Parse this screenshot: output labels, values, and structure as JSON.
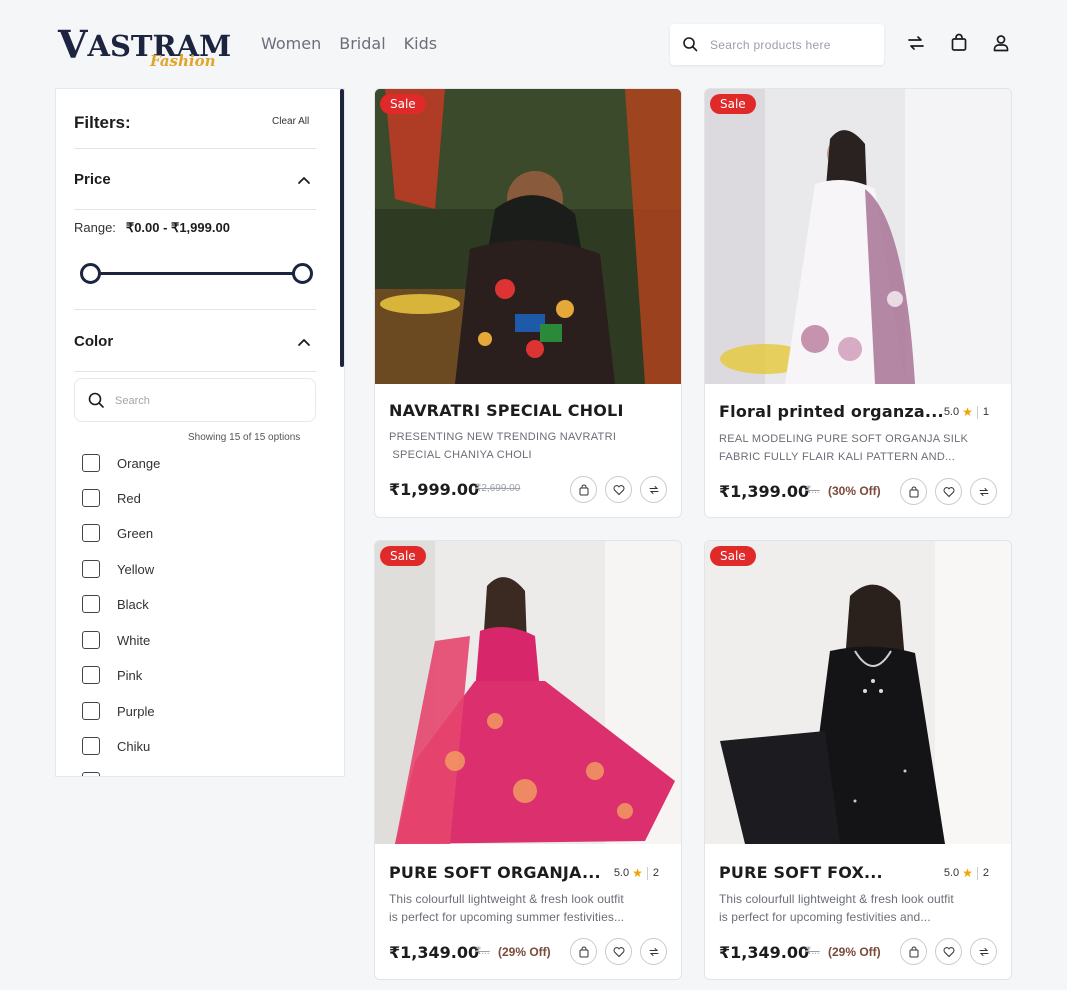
{
  "header": {
    "logo_main": "ASTRAM",
    "logo_v": "V",
    "logo_sub": "Fashion",
    "nav": [
      "Women",
      "Bridal",
      "Kids"
    ],
    "search_placeholder": "Search products here",
    "icons": [
      "search-icon",
      "compare-icon",
      "bag-icon",
      "user-icon"
    ]
  },
  "filters": {
    "title": "Filters:",
    "clear_all": "Clear All",
    "price": {
      "title": "Price",
      "range_label": "Range:",
      "range_value": "₹0.00 - ₹1,999.00",
      "min_fraction": 0,
      "max_fraction": 1
    },
    "color": {
      "title": "Color",
      "search_placeholder": "Search",
      "showing": "Showing 15 of 15 options",
      "options": [
        "Orange",
        "Red",
        "Green",
        "Yellow",
        "Black",
        "White",
        "Pink",
        "Purple",
        "Chiku"
      ]
    }
  },
  "products": [
    {
      "badge": "Sale",
      "name": "NAVRATRI SPECIAL CHOLI",
      "rating": "",
      "rating_count": "",
      "desc_line1": "PRESENTING NEW  TRENDING NAVRATRI",
      "desc_line2": " SPECIAL CHANIYA CHOLI",
      "price": "₹1,999.00",
      "mrp": "₹2,699.00",
      "off": ""
    },
    {
      "badge": "Sale",
      "name": "Floral printed organza...",
      "rating": "5.0",
      "rating_count": "1",
      "desc_line1": "REAL MODELING PURE SOFT ORGANJA SILK",
      "desc_line2": "FABRIC FULLY FLAIR KALI PATTERN AND...",
      "price": "₹1,399.00",
      "mrp": "₹...",
      "off": "(30% Off)"
    },
    {
      "badge": "Sale",
      "name": "PURE SOFT ORGANJA...",
      "rating": "5.0",
      "rating_count": "2",
      "desc_line1": "This colourfull lightweight & fresh look outfit",
      "desc_line2": "is perfect for upcoming summer festivities...",
      "price": "₹1,349.00",
      "mrp": "₹...",
      "off": "(29% Off)"
    },
    {
      "badge": "Sale",
      "name": "PURE SOFT FOX...",
      "rating": "5.0",
      "rating_count": "2",
      "desc_line1": "This colourfull lightweight & fresh look outfit",
      "desc_line2": "is perfect for upcoming festivities and...",
      "price": "₹1,349.00",
      "mrp": "₹...",
      "off": "(29% Off)"
    }
  ],
  "colors": {
    "brand_navy": "#1c2440",
    "brand_gold": "#e0a52a",
    "sale_red": "#e02a2a",
    "star": "#f0a400"
  }
}
